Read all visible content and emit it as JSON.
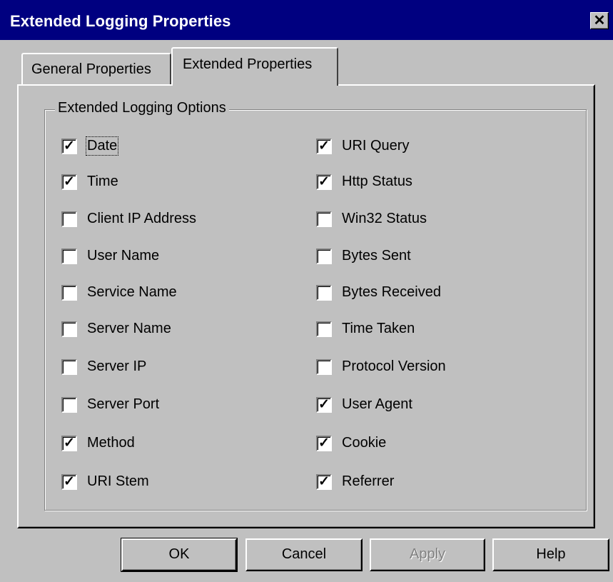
{
  "window": {
    "title": "Extended Logging Properties",
    "close_glyph": "✕"
  },
  "tabs": [
    {
      "label": "General Properties",
      "active": false
    },
    {
      "label": "Extended Properties",
      "active": true
    }
  ],
  "group": {
    "legend": "Extended Logging Options"
  },
  "options_left": [
    {
      "label": "Date",
      "checked": true
    },
    {
      "label": "Time",
      "checked": true
    },
    {
      "label": "Client IP Address",
      "checked": false
    },
    {
      "label": "User Name",
      "checked": false
    },
    {
      "label": "Service Name",
      "checked": false
    },
    {
      "label": "Server Name",
      "checked": false
    },
    {
      "label": "Server IP",
      "checked": false
    },
    {
      "label": "Server Port",
      "checked": false
    },
    {
      "label": "Method",
      "checked": true
    },
    {
      "label": "URI Stem",
      "checked": true
    }
  ],
  "options_right": [
    {
      "label": "URI Query",
      "checked": true
    },
    {
      "label": "Http Status",
      "checked": true
    },
    {
      "label": "Win32 Status",
      "checked": false
    },
    {
      "label": "Bytes Sent",
      "checked": false
    },
    {
      "label": "Bytes Received",
      "checked": false
    },
    {
      "label": "Time Taken",
      "checked": false
    },
    {
      "label": "Protocol Version",
      "checked": false
    },
    {
      "label": "User Agent",
      "checked": true
    },
    {
      "label": "Cookie",
      "checked": true
    },
    {
      "label": "Referrer",
      "checked": true
    }
  ],
  "checkmark_glyph": "✓",
  "buttons": {
    "ok": "OK",
    "cancel": "Cancel",
    "apply": "Apply",
    "help": "Help"
  }
}
